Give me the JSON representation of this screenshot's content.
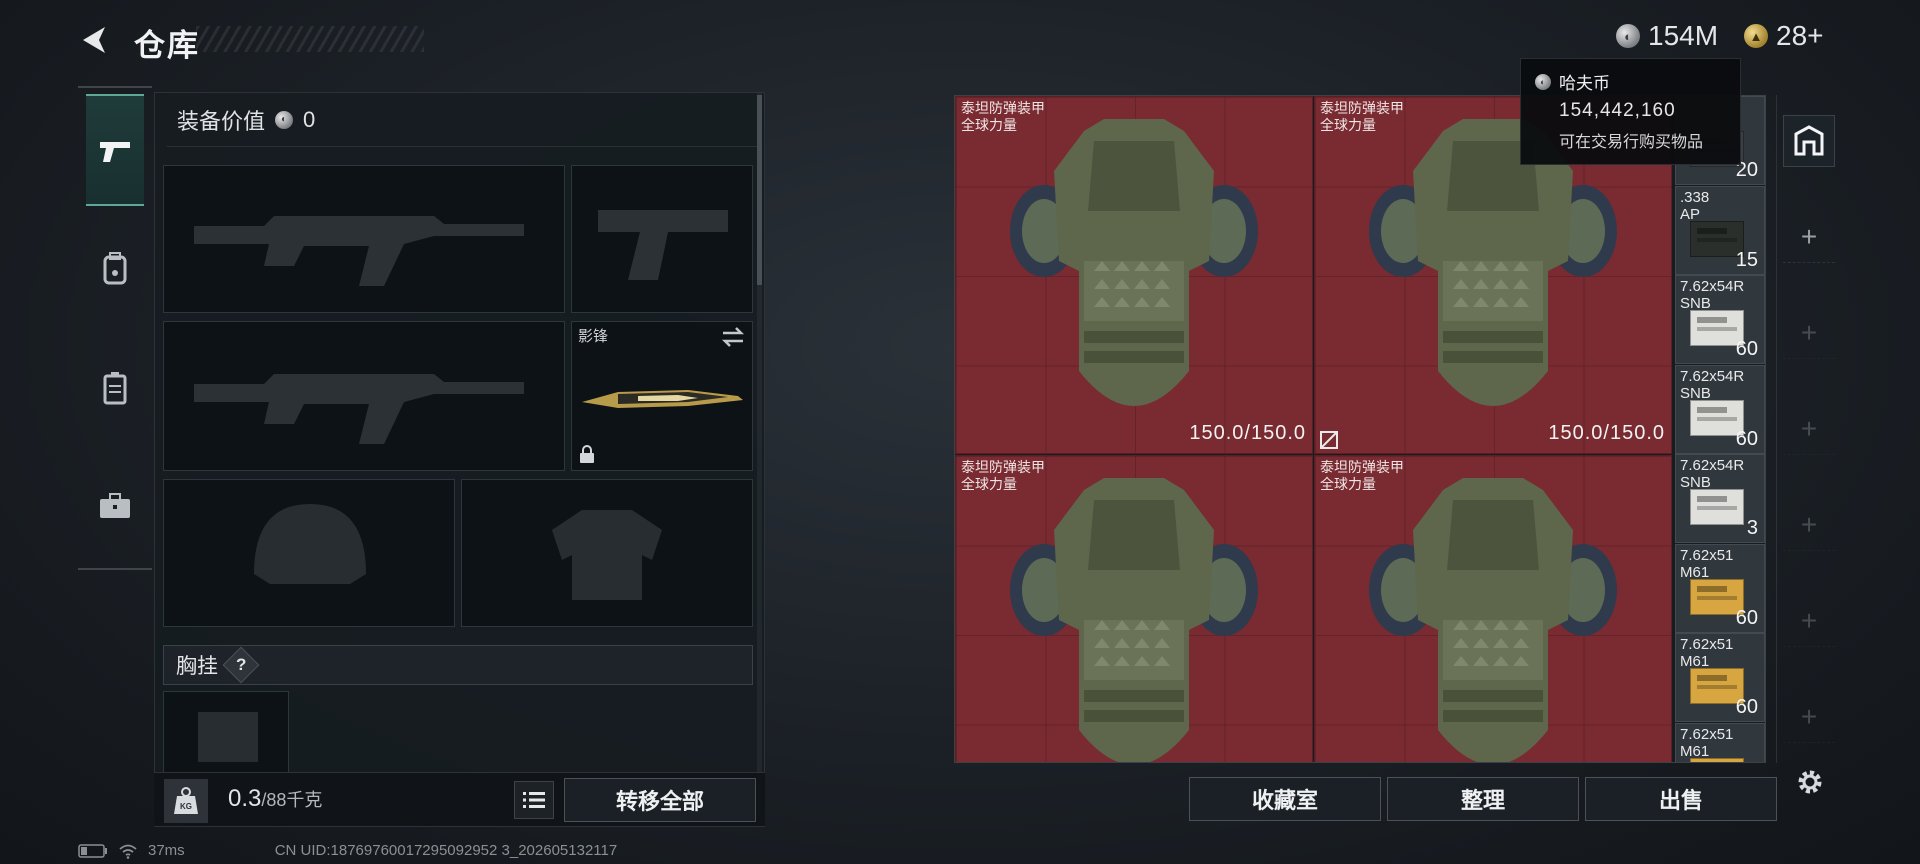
{
  "header": {
    "title": "仓库",
    "currency_main": "154M",
    "currency_secondary": "28+"
  },
  "tabs": [
    {
      "name": "weapons",
      "icon": "pistol-icon",
      "active": true
    },
    {
      "name": "backpack",
      "icon": "backpack-icon",
      "active": false
    },
    {
      "name": "rig",
      "icon": "vest-icon",
      "active": false
    },
    {
      "name": "case",
      "icon": "briefcase-icon",
      "active": false
    }
  ],
  "equipment": {
    "value_label": "装备价值",
    "value_amount": "0",
    "melee_slot_label": "影锋",
    "chest_rig_label": "胸挂",
    "help_mark": "?"
  },
  "weight": {
    "current": "0.3",
    "max": "/88千克",
    "icon_text": "KG"
  },
  "buttons": {
    "transfer_all": "转移全部",
    "collection_room": "收藏室",
    "organize": "整理",
    "sell": "出售"
  },
  "stash": {
    "armor_items": [
      {
        "name_line1": "泰坦防弹装甲",
        "name_line2": "全球力量",
        "durability": "150.0/150.0"
      },
      {
        "name_line1": "泰坦防弹装甲",
        "name_line2": "全球力量",
        "durability": "150.0/150.0"
      },
      {
        "name_line1": "泰坦防弹装甲",
        "name_line2": "全球力量",
        "durability": ""
      },
      {
        "name_line1": "泰坦防弹装甲",
        "name_line2": "全球力量",
        "durability": ""
      }
    ],
    "ammo_items": [
      {
        "name_line1": "",
        "name_line2": "",
        "count": "20",
        "box_color": "#3a3f44"
      },
      {
        "name_line1": ".338",
        "name_line2": "AP",
        "count": "15",
        "box_color": "#2a2f2c"
      },
      {
        "name_line1": "7.62x54R",
        "name_line2": "SNB",
        "count": "60",
        "box_color": "#dfe0dc"
      },
      {
        "name_line1": "7.62x54R",
        "name_line2": "SNB",
        "count": "60",
        "box_color": "#dfe0dc"
      },
      {
        "name_line1": "7.62x54R",
        "name_line2": "SNB",
        "count": "3",
        "box_color": "#dfe0dc"
      },
      {
        "name_line1": "7.62x51",
        "name_line2": "M61",
        "count": "60",
        "box_color": "#d8a640"
      },
      {
        "name_line1": "7.62x51",
        "name_line2": "M61",
        "count": "60",
        "box_color": "#d8a640"
      },
      {
        "name_line1": "7.62x51",
        "name_line2": "M61",
        "count": "",
        "box_color": "#d8a640"
      }
    ]
  },
  "tooltip": {
    "title": "哈夫币",
    "amount": "154,442,160",
    "desc": "可在交易行购买物品"
  },
  "status_bar": {
    "ping": "37ms",
    "uid": "CN UID:18769760017295092952 3_202605132117"
  }
}
